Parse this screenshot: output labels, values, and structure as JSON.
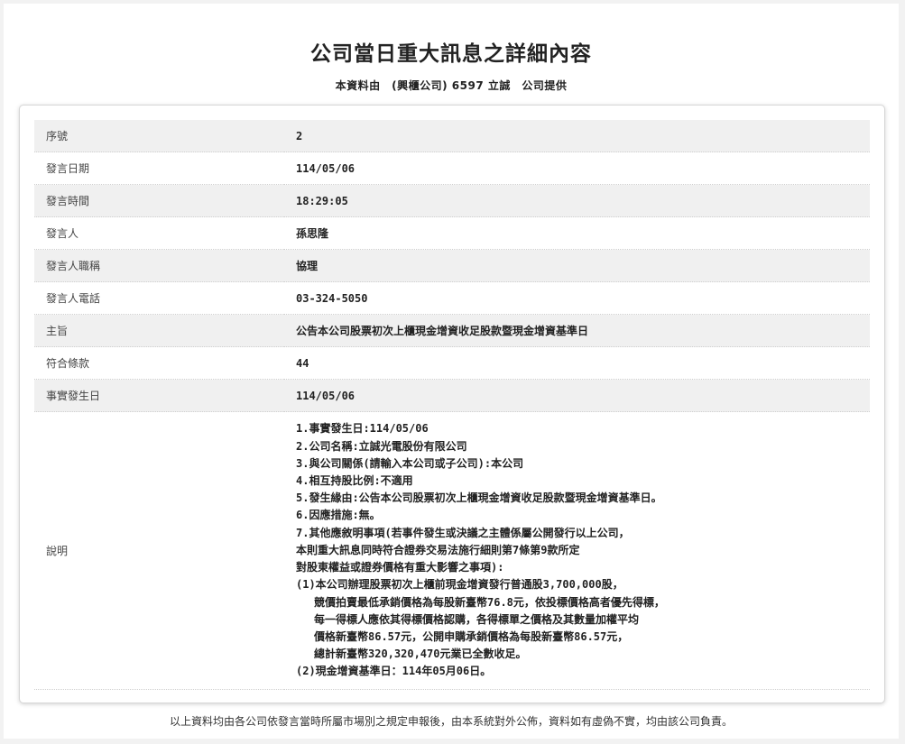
{
  "title": "公司當日重大訊息之詳細內容",
  "subtitle": "本資料由　(興櫃公司) 6597 立誠　公司提供",
  "rows": [
    {
      "label": "序號",
      "value": "2"
    },
    {
      "label": "發言日期",
      "value": "114/05/06"
    },
    {
      "label": "發言時間",
      "value": "18:29:05"
    },
    {
      "label": "發言人",
      "value": "孫思隆"
    },
    {
      "label": "發言人職稱",
      "value": "協理"
    },
    {
      "label": "發言人電話",
      "value": "03-324-5050"
    },
    {
      "label": "主旨",
      "value": "公告本公司股票初次上櫃現金增資收足股款暨現金增資基準日"
    },
    {
      "label": "符合條款",
      "value": "44"
    },
    {
      "label": "事實發生日",
      "value": "114/05/06"
    }
  ],
  "description": {
    "label": "說明",
    "lines": [
      "1.事實發生日:114/05/06",
      "2.公司名稱:立誠光電股份有限公司",
      "3.與公司關係(請輸入本公司或子公司):本公司",
      "4.相互持股比例:不適用",
      "5.發生緣由:公告本公司股票初次上櫃現金增資收足股款暨現金增資基準日。",
      "6.因應措施:無。",
      "7.其他應敘明事項(若事件發生或決議之主體係屬公開發行以上公司，",
      "本則重大訊息同時符合證券交易法施行細則第7條第9款所定",
      "對股東權益或證券價格有重大影響之事項):",
      "(1)本公司辦理股票初次上櫃前現金增資發行普通股3,700,000股，",
      "競價拍賣最低承銷價格為每股新臺幣76.8元，依投標價格高者優先得標，",
      "每一得標人應依其得標價格認購，各得標單之價格及其數量加權平均",
      "價格新臺幣86.57元，公開申購承銷價格為每股新臺幣86.57元，",
      "總計新臺幣320,320,470元業已全數收足。",
      "(2)現金增資基準日：114年05月06日。"
    ]
  },
  "footer": "以上資料均由各公司依發言當時所屬市場別之規定申報後，由本系統對外公佈，資料如有虛偽不實，均由該公司負責。"
}
